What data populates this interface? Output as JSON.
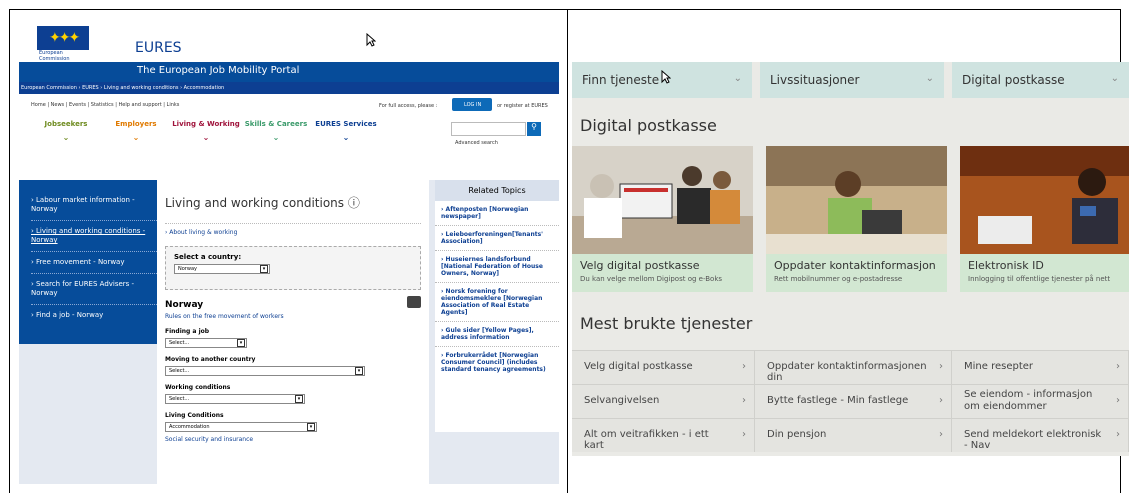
{
  "eures": {
    "logo_label": "European Commission",
    "title": "EURES",
    "subtitle": "The European Job Mobility Portal",
    "breadcrumb": "European Commission  ›  EURES  ›  Living and working conditions  ›  Accommodation",
    "top_links": "Home | News | Events | Statistics | Help and support | Links",
    "access_text": "For full access, please :",
    "login_label": "LOG IN",
    "register_text": "or register at EURES",
    "nav": [
      {
        "label": "Jobseekers",
        "color": "#6e8b1f"
      },
      {
        "label": "Employers",
        "color": "#e07a00"
      },
      {
        "label": "Living & Working",
        "color": "#a0143c"
      },
      {
        "label": "Skills & Careers",
        "color": "#3a9a6a"
      },
      {
        "label": "EURES Services",
        "color": "#0d3f92"
      }
    ],
    "advanced_search": "Advanced search",
    "left_links": [
      "› Labour market information - Norway",
      "› Living and working conditions - Norway",
      "› Free movement - Norway",
      "› Search for EURES Advisers - Norway",
      "› Find a job - Norway"
    ],
    "main": {
      "title": "Living and working conditions",
      "about": "› About living & working",
      "select_country_label": "Select a country:",
      "country_value": "Norway",
      "country_heading": "Norway",
      "rules_link": "Rules on the free movement of workers",
      "finding_job": "Finding a job",
      "finding_job_value": "Select...",
      "moving": "Moving to another country",
      "moving_value": "Select...",
      "working": "Working conditions",
      "working_value": "Select...",
      "living": "Living Conditions",
      "living_value": "Accommodation",
      "social": "Social security and insurance"
    },
    "related_title": "Related Topics",
    "related": [
      "› Aftenposten [Norwegian newspaper]",
      "› Leieboerforeningen[Tenants' Association]",
      "› Huseiernes landsforbund [National Federation of House Owners, Norway]",
      "› Norsk forening for eiendomsmeklere [Norwegian Association of Real Estate Agents]",
      "› Gule sider [Yellow Pages], address information",
      "› Forbrukerrådet [Norwegian Consumer Council] (includes standard tenancy agreements)"
    ]
  },
  "norway": {
    "tabs": [
      "Finn tjeneste",
      "Livssituasjoner",
      "Digital postkasse"
    ],
    "section_title": "Digital postkasse",
    "cards": [
      {
        "title": "Velg digital postkasse",
        "subtitle": "Du kan velge mellom Digipost og e-Boks"
      },
      {
        "title": "Oppdater kontaktinformasjon",
        "subtitle": "Rett mobilnummer og e-postadresse"
      },
      {
        "title": "Elektronisk ID",
        "subtitle": "Innlogging til offentlige tjenester på nett"
      }
    ],
    "section2_title": "Mest brukte tjenester",
    "services": [
      "Velg digital postkasse",
      "Oppdater kontaktinformasjonen din",
      "Mine resepter",
      "Selvangivelsen",
      "Bytte fastlege - Min fastlege",
      "Se eiendom - informasjon om eiendommer",
      "Alt om veitrafikken - i ett kart",
      "Din pensjon",
      "Send meldekort elektronisk - Nav"
    ]
  }
}
